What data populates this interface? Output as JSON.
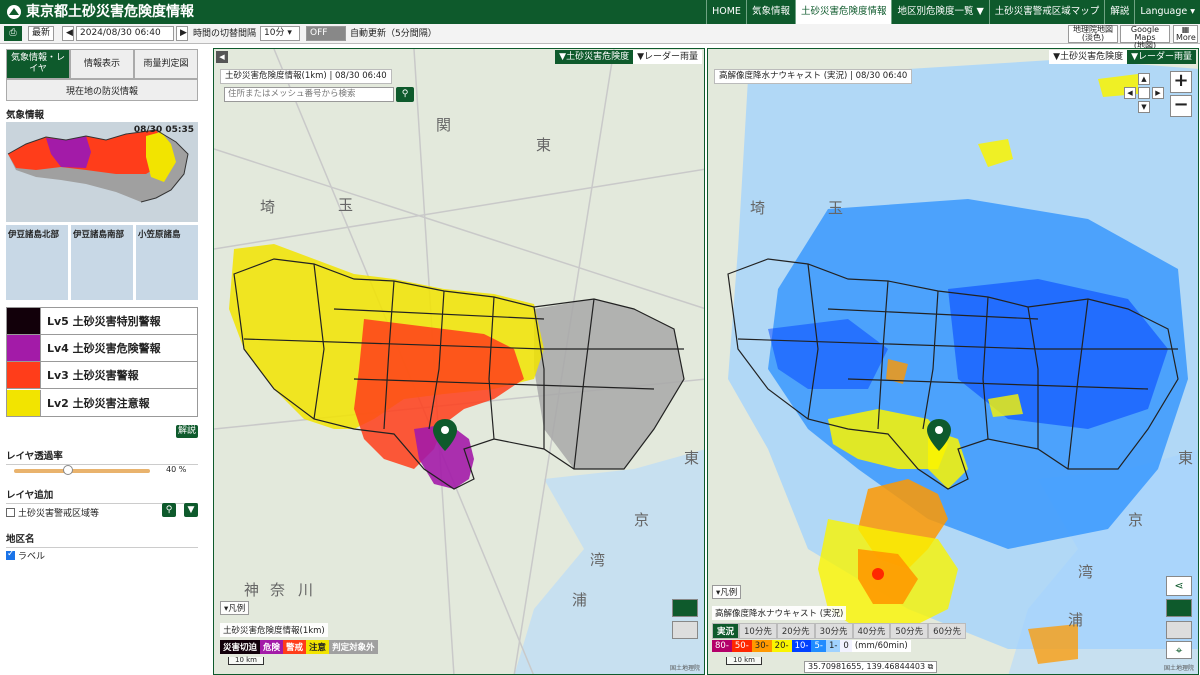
{
  "header": {
    "title": "東京都土砂災害危険度情報",
    "nav": [
      "HOME",
      "気象情報",
      "土砂災害危険度情報",
      "地区別危険度一覧 ▼",
      "土砂災害警戒区域マップ",
      "解説",
      "Language ▾"
    ],
    "active_nav_index": 2
  },
  "toolbar": {
    "latest": "最新",
    "datetime": "2024/08/30 06:40",
    "interval_label": "時間の切替間隔",
    "interval_value": "10分",
    "auto_toggle": "OFF",
    "auto_update": "自動更新（5分間隔）",
    "basemap_btn": [
      "地理院地図",
      "(淡色)"
    ],
    "google_btn": [
      "Google Maps",
      "(地図)"
    ],
    "more_btn": "More"
  },
  "sidebar": {
    "tabs": [
      "気象情報・レイヤ",
      "情報表示",
      "雨量判定図"
    ],
    "current_pos_button": "現在地の防災情報",
    "weather_title": "気象情報",
    "weather_time": "08/30 05:35",
    "islands": [
      "伊豆諸島北部",
      "伊豆諸島南部",
      "小笠原諸島"
    ],
    "levels": [
      {
        "label": "Lv5 土砂災害特別警報",
        "color": "#12000a"
      },
      {
        "label": "Lv4 土砂災害危険警報",
        "color": "#a31ba8"
      },
      {
        "label": "Lv3 土砂災害警報",
        "color": "#ff3d1a"
      },
      {
        "label": "Lv2 土砂災害注意報",
        "color": "#f2e400"
      }
    ],
    "explain_btn": "解説",
    "opacity_title": "レイヤ透過率",
    "opacity_value": "40 %",
    "opacity_level": 0.4,
    "layer_add_title": "レイヤ追加",
    "layer_add_item": "土砂災害警戒区域等",
    "district_title": "地区名",
    "district_item": "ラベル"
  },
  "left_map": {
    "switch": [
      "▼土砂災害危険度",
      "▼レーダー雨量"
    ],
    "title": "土砂災害危険度情報(1km) | 08/30 06:40",
    "search_placeholder": "住所またはメッシュ番号から検索",
    "legend_toggle": "▾凡例",
    "legend_title": "土砂災害危険度情報(1km)",
    "legend_items": [
      {
        "label": "災害切迫",
        "color": "#12000a"
      },
      {
        "label": "危険",
        "color": "#a31ba8"
      },
      {
        "label": "警戒",
        "color": "#ff3d1a"
      },
      {
        "label": "注意",
        "color": "#f2e400"
      },
      {
        "label": "判定対象外",
        "color": "#a0a0a0"
      }
    ],
    "scale": "10 km",
    "labels": [
      "関",
      "東",
      "玉",
      "埼",
      "神",
      "奈",
      "川",
      "東",
      "京",
      "湾",
      "浦"
    ]
  },
  "right_map": {
    "switch": [
      "▼土砂災害危険度",
      "▼レーダー雨量"
    ],
    "title": "高解像度降水ナウキャスト (実況) | 08/30 06:40",
    "legend_toggle": "▾凡例",
    "legend_title": "高解像度降水ナウキャスト (実況)",
    "time_tabs": [
      "実況",
      "10分先",
      "20分先",
      "30分先",
      "40分先",
      "50分先",
      "60分先"
    ],
    "rain_scale": [
      {
        "label": "80-",
        "color": "#b4006a"
      },
      {
        "label": "50-",
        "color": "#ff2800"
      },
      {
        "label": "30-",
        "color": "#ff9900"
      },
      {
        "label": "20-",
        "color": "#faf500"
      },
      {
        "label": "10-",
        "color": "#0041ff"
      },
      {
        "label": "5-",
        "color": "#218cff"
      },
      {
        "label": "1-",
        "color": "#a0d2ff"
      },
      {
        "label": "0",
        "color": "#f2f2ff"
      }
    ],
    "unit": "(mm/60min)",
    "scale": "10 km",
    "coords": "35.70981655, 139.46844403",
    "labels": [
      "埼",
      "玉",
      "東",
      "京",
      "湾",
      "浦"
    ]
  },
  "attribution": "国土地理院"
}
